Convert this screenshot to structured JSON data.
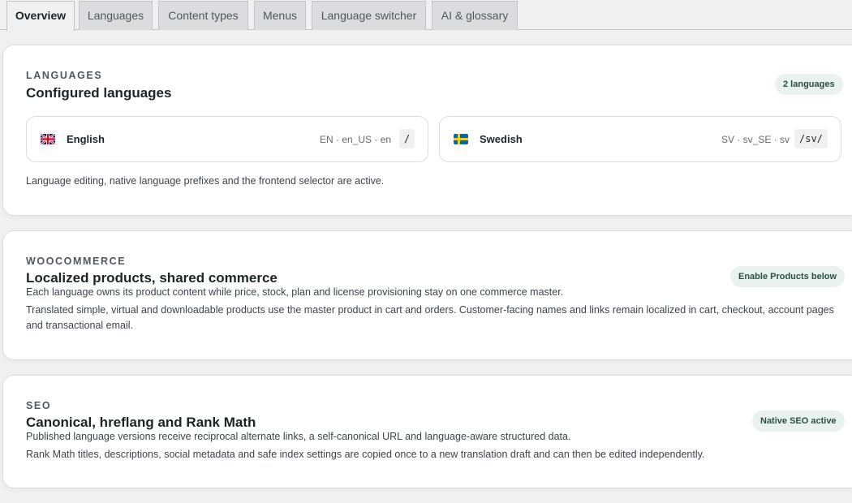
{
  "tabs": [
    {
      "label": "Overview",
      "active": true
    },
    {
      "label": "Languages"
    },
    {
      "label": "Content types"
    },
    {
      "label": "Menus"
    },
    {
      "label": "Language switcher"
    },
    {
      "label": "AI & glossary"
    }
  ],
  "languages_card": {
    "eyebrow": "LANGUAGES",
    "title": "Configured languages",
    "badge": "2 languages",
    "languages": [
      {
        "flag": "uk-flag-icon",
        "name": "English",
        "codes": "EN · en_US · en",
        "prefix": "/"
      },
      {
        "flag": "sweden-flag-icon",
        "name": "Swedish",
        "codes": "SV · sv_SE · sv",
        "prefix": "/sv/"
      }
    ],
    "note": "Language editing, native language prefixes and the frontend selector are active."
  },
  "woocommerce_card": {
    "eyebrow": "WOOCOMMERCE",
    "title": "Localized products, shared commerce",
    "badge": "Enable Products below",
    "line1": "Each language owns its product content while price, stock, plan and license provisioning stay on one commerce master.",
    "line2": "Translated simple, virtual and downloadable products use the master product in cart and orders. Customer-facing names and links remain localized in cart, checkout, account pages and transactional email."
  },
  "seo_card": {
    "eyebrow": "SEO",
    "title": "Canonical, hreflang and Rank Math",
    "badge": "Native SEO active",
    "line1": "Published language versions receive reciprocal alternate links, a self-canonical URL and language-aware structured data.",
    "line2": "Rank Math titles, descriptions, social metadata and safe index settings are copied once to a new translation draft and can then be edited independently."
  },
  "colors": {
    "background": "#f0f0f1",
    "badge_bg": "#eaf2ef",
    "badge_text": "#2c4f44"
  }
}
